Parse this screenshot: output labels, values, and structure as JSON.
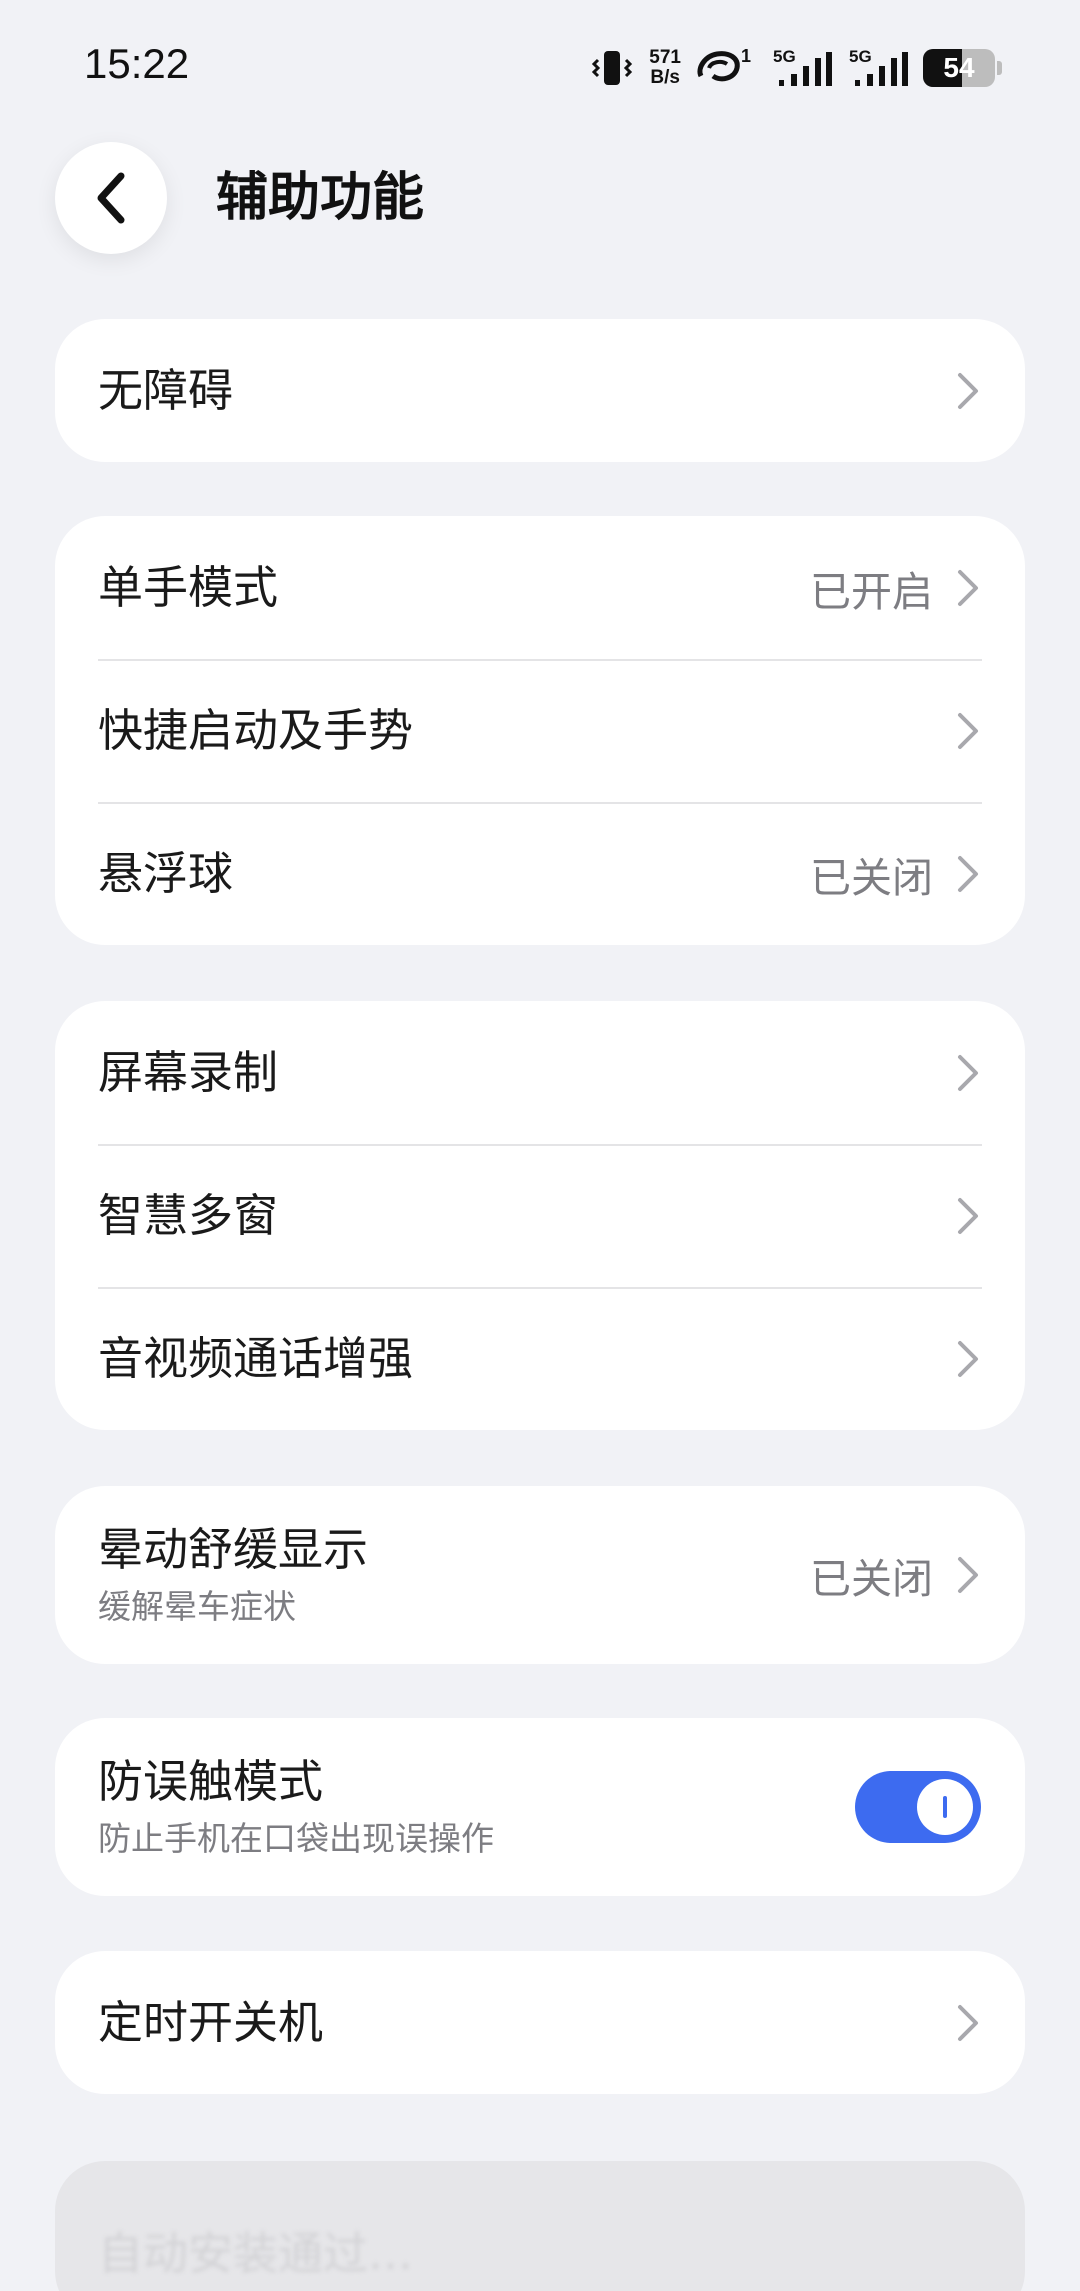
{
  "status_bar": {
    "time": "15:22",
    "net_speed_top": "571",
    "net_speed_bottom": "B/s",
    "sim1_label": "5G",
    "sim2_label": "5G",
    "hd_label": "1",
    "battery_level": "54",
    "battery_fraction": 0.54
  },
  "header": {
    "title": "辅助功能"
  },
  "groups": {
    "g1": {
      "accessibility": {
        "label": "无障碍"
      }
    },
    "g2": {
      "one_hand": {
        "label": "单手模式",
        "value": "已开启"
      },
      "quick_launch": {
        "label": "快捷启动及手势"
      },
      "float_ball": {
        "label": "悬浮球",
        "value": "已关闭"
      }
    },
    "g3": {
      "screen_record": {
        "label": "屏幕录制"
      },
      "multi_window": {
        "label": "智慧多窗"
      },
      "call_enhance": {
        "label": "音视频通话增强"
      }
    },
    "g4": {
      "motion_comfort": {
        "label": "晕动舒缓显示",
        "sub": "缓解晕车症状",
        "value": "已关闭"
      }
    },
    "g5": {
      "anti_touch": {
        "label": "防误触模式",
        "sub": "防止手机在口袋出现误操作",
        "toggle_on": true
      }
    },
    "g6": {
      "scheduled_power": {
        "label": "定时开关机"
      }
    },
    "g7": {
      "faded_item": {
        "label": "自动安装通过…"
      }
    }
  },
  "colors": {
    "accent": "#3d6bf0",
    "background": "#f1f2f6",
    "secondary_text": "#7d7d82"
  },
  "icons": {
    "back": "chevron-left-icon",
    "row_arrow": "chevron-right-icon"
  }
}
